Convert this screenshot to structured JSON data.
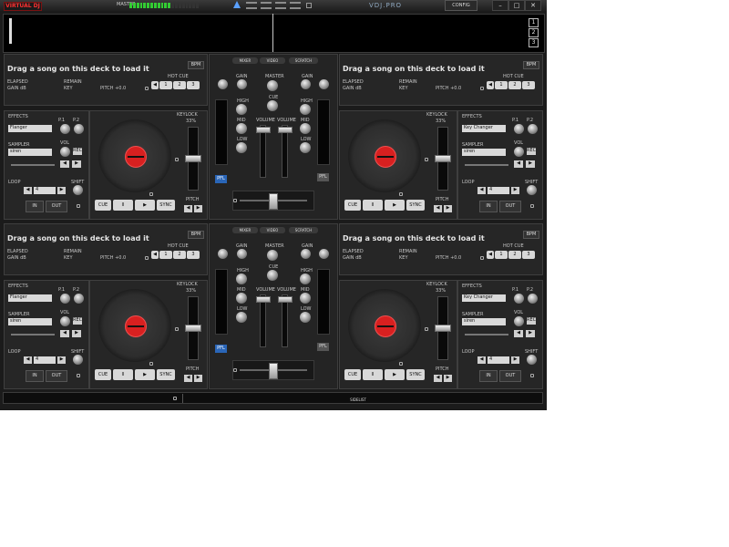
{
  "app": {
    "logo_text": "VIRTUAL DJ",
    "text_logo": "VDJ.PRO",
    "config_label": "CONFIG",
    "master_label": "MASTER"
  },
  "window": {
    "min": "–",
    "max": "□",
    "close": "✕"
  },
  "deck_numbers": [
    "1",
    "2",
    "3"
  ],
  "decks": [
    {
      "id": "deck-1",
      "title": "Drag a song on this deck to load it",
      "elapsed": "ELAPSED",
      "gain": "GAIN dB",
      "remain": "REMAIN",
      "key": "KEY",
      "pitch": "PITCH +0.0",
      "bpm": "BPM",
      "hot_cue": "HOT CUE",
      "cues": [
        "1",
        "2",
        "3"
      ],
      "effects": "EFFECTS",
      "effect_value": "Flanger",
      "p1": "P.1",
      "p2": "P.2",
      "sampler": "SAMPLER",
      "sampler_value": "siren",
      "vol": "VOL",
      "rec": "REC",
      "loop": "LOOP",
      "loop_value": "4",
      "shift": "SHIFT",
      "in": "IN",
      "out": "OUT",
      "cue": "CUE",
      "pause": "II",
      "play": "▶",
      "sync": "SYNC",
      "keylock": "KEYLOCK",
      "keylock_pct": "33%",
      "pitch_label": "PITCH"
    },
    {
      "id": "deck-2",
      "title": "Drag a song on this deck to load it",
      "elapsed": "ELAPSED",
      "gain": "GAIN dB",
      "remain": "REMAIN",
      "key": "KEY",
      "pitch": "PITCH +0.0",
      "bpm": "BPM",
      "hot_cue": "HOT CUE",
      "cues": [
        "1",
        "2",
        "3"
      ],
      "effects": "EFFECTS",
      "effect_value": "Key Changer",
      "p1": "P.1",
      "p2": "P.2",
      "sampler": "SAMPLER",
      "sampler_value": "siren",
      "vol": "VOL",
      "rec": "REC",
      "loop": "LOOP",
      "loop_value": "4",
      "shift": "SHIFT",
      "in": "IN",
      "out": "OUT",
      "cue": "CUE",
      "pause": "II",
      "play": "▶",
      "sync": "SYNC",
      "keylock": "KEYLOCK",
      "keylock_pct": "33%",
      "pitch_label": "PITCH"
    },
    {
      "id": "deck-3",
      "title": "Drag a song on this deck to load it",
      "elapsed": "ELAPSED",
      "gain": "GAIN dB",
      "remain": "REMAIN",
      "key": "KEY",
      "pitch": "PITCH +0.0",
      "bpm": "BPM",
      "hot_cue": "HOT CUE",
      "cues": [
        "1",
        "2",
        "3"
      ],
      "effects": "EFFECTS",
      "effect_value": "Flanger",
      "p1": "P.1",
      "p2": "P.2",
      "sampler": "SAMPLER",
      "sampler_value": "siren",
      "vol": "VOL",
      "rec": "REC",
      "loop": "LOOP",
      "loop_value": "4",
      "shift": "SHIFT",
      "in": "IN",
      "out": "OUT",
      "cue": "CUE",
      "pause": "II",
      "play": "▶",
      "sync": "SYNC",
      "keylock": "KEYLOCK",
      "keylock_pct": "33%",
      "pitch_label": "PITCH"
    },
    {
      "id": "deck-4",
      "title": "Drag a song on this deck to load it",
      "elapsed": "ELAPSED",
      "gain": "GAIN dB",
      "remain": "REMAIN",
      "key": "KEY",
      "pitch": "PITCH +0.0",
      "bpm": "BPM",
      "hot_cue": "HOT CUE",
      "cues": [
        "1",
        "2",
        "3"
      ],
      "effects": "EFFECTS",
      "effect_value": "Key Changer",
      "p1": "P.1",
      "p2": "P.2",
      "sampler": "SAMPLER",
      "sampler_value": "siren",
      "vol": "VOL",
      "rec": "REC",
      "loop": "LOOP",
      "loop_value": "4",
      "shift": "SHIFT",
      "in": "IN",
      "out": "OUT",
      "cue": "CUE",
      "pause": "II",
      "play": "▶",
      "sync": "SYNC",
      "keylock": "KEYLOCK",
      "keylock_pct": "33%",
      "pitch_label": "PITCH"
    }
  ],
  "mixers": [
    {
      "tabs": [
        "MIXER",
        "VIDEO",
        "SCRATCH"
      ],
      "gain": "GAIN",
      "master": "MASTER",
      "cue": "CUE",
      "high": "HIGH",
      "mid": "MID",
      "low": "LOW",
      "volume": "VOLUME",
      "pfl": "PFL"
    },
    {
      "tabs": [
        "MIXER",
        "VIDEO",
        "SCRATCH"
      ],
      "gain": "GAIN",
      "master": "MASTER",
      "cue": "CUE",
      "high": "HIGH",
      "mid": "MID",
      "low": "LOW",
      "volume": "VOLUME",
      "pfl": "PFL"
    }
  ],
  "bottom": {
    "sidelist": "SIDELIST"
  },
  "colors": {
    "accent_red": "#d82020",
    "pfl_blue": "#2a66b8",
    "meter_green": "#33cc33",
    "waveform_bg": "#000000"
  },
  "icons": [
    "lock-icon",
    "arrow-icon",
    "layout-icon"
  ]
}
